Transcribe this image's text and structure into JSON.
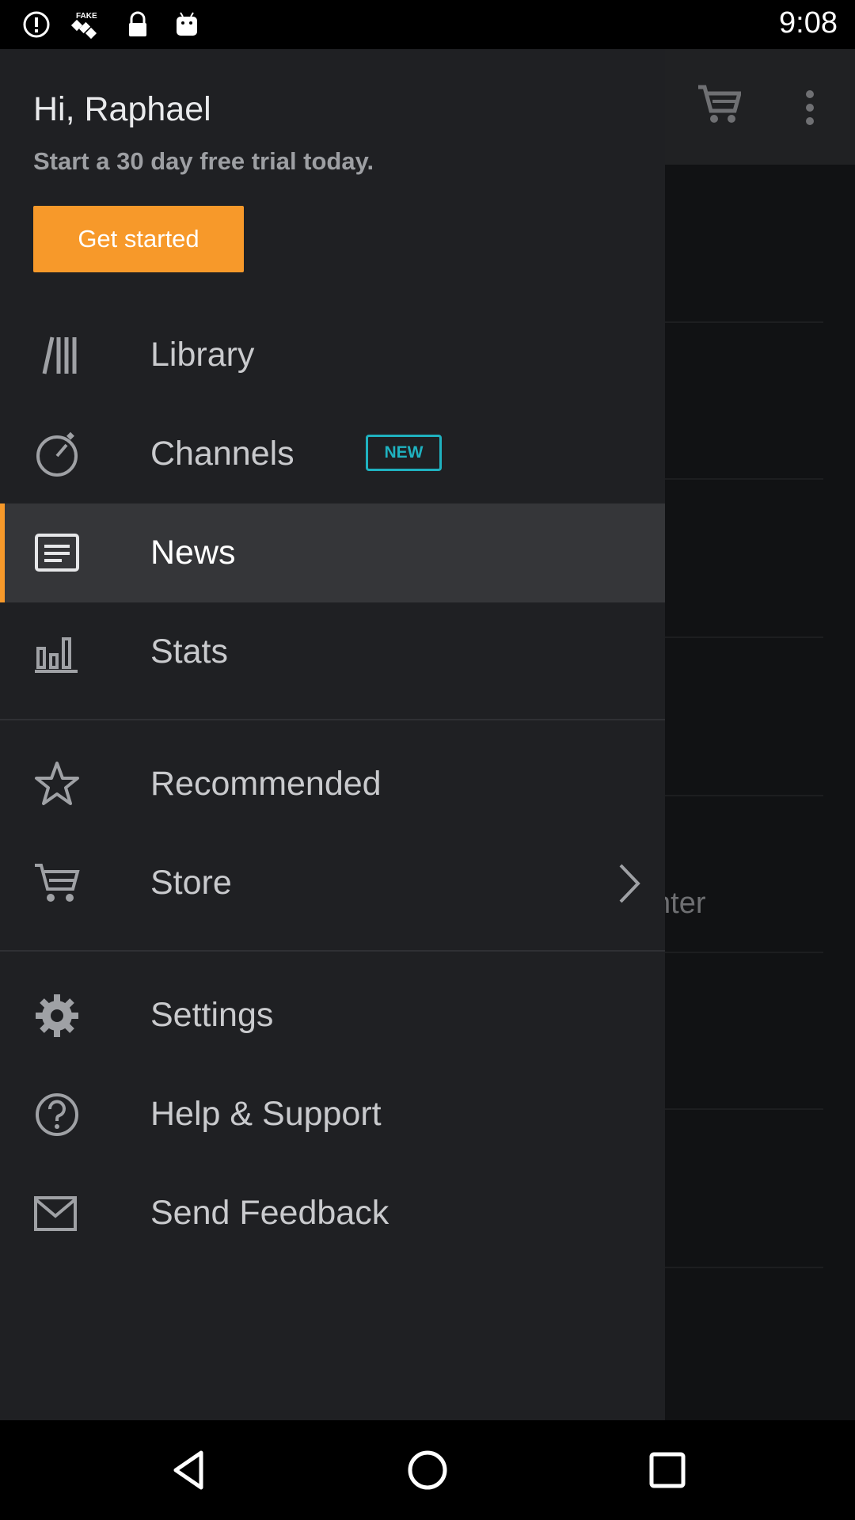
{
  "status_bar": {
    "time": "9:08",
    "icons": [
      "alert-circle-icon",
      "satellite-icon",
      "lock-icon",
      "android-icon"
    ]
  },
  "background_app": {
    "toolbar_icons": [
      "cart-icon",
      "more-vert-icon"
    ],
    "partial_text": "nter"
  },
  "drawer": {
    "greeting": "Hi, Raphael",
    "subtitle": "Start a 30 day free trial today.",
    "cta_label": "Get started",
    "accent_color": "#f7992a",
    "badge_color": "#1fb2c0",
    "items": [
      {
        "label": "Library",
        "icon": "library-icon"
      },
      {
        "label": "Channels",
        "icon": "channels-icon",
        "badge": "NEW"
      },
      {
        "label": "News",
        "icon": "news-icon",
        "active": true
      },
      {
        "label": "Stats",
        "icon": "stats-icon"
      },
      {
        "label": "Recommended",
        "icon": "star-icon"
      },
      {
        "label": "Store",
        "icon": "cart-icon",
        "chevron": "chevron-right-icon"
      },
      {
        "label": "Settings",
        "icon": "gear-icon"
      },
      {
        "label": "Help & Support",
        "icon": "help-icon"
      },
      {
        "label": "Send Feedback",
        "icon": "mail-icon"
      }
    ]
  },
  "nav_bar": {
    "icons": [
      "back-icon",
      "home-icon",
      "recents-icon"
    ]
  }
}
